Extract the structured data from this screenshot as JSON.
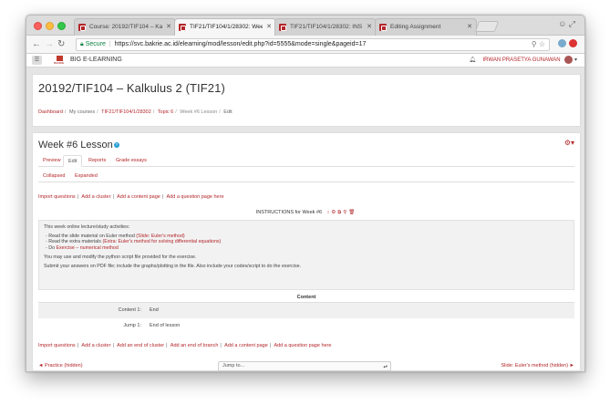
{
  "browser": {
    "tabs": [
      {
        "title": "Course: 20192/TIF104 – Kalk",
        "active": false
      },
      {
        "title": "TIF21/TIF104/1/28302: Wee",
        "active": true
      },
      {
        "title": "TIF21/TIF104/1/28302: INS",
        "active": false
      },
      {
        "title": "Editing Assignment",
        "active": false
      }
    ],
    "secure_label": "Secure",
    "url": "https://svc.bakrie.ac.id/elearning/mod/lesson/edit.php?id=5555&mode=single&pageid=17"
  },
  "navbar": {
    "logo_text": "BAKRIE",
    "site_name": "BIG E-LEARNING",
    "user_name": "IRWAN PRASETYA GUNAWAN"
  },
  "header": {
    "course_title": "20192/TIF104 – Kalkulus 2 (TIF21)",
    "breadcrumb": [
      "Dashboard",
      "My courses",
      "TIF21/TIF104/1/28302",
      "Topic 6",
      "Week #6 Lesson",
      "Edit"
    ]
  },
  "lesson": {
    "title": "Week #6 Lesson",
    "tabs": [
      "Preview",
      "Edit",
      "Reports",
      "Grade essays"
    ],
    "active_tab": "Edit",
    "subtabs": [
      "Collapsed",
      "Expanded"
    ],
    "top_links": [
      "Import questions",
      "Add a cluster",
      "Add a content page",
      "Add a question page here"
    ],
    "page_heading": "INSTRUCTIONS for Week #6",
    "description": {
      "intro": "This week online lecture/study activities:",
      "items": [
        {
          "text": "Read the slide material on Euler method ",
          "link": "(Slide: Euler's method)"
        },
        {
          "text": "Read the extra materials ",
          "link": "(Extra: Euler's method for solving differential equations)"
        },
        {
          "text": "Do ",
          "link": "Exercise – numerical method"
        }
      ],
      "note1": "You may use and modify the python script file provided for the exercise.",
      "note2": "Submit your answers on PDF file; include the graphs/plotting in the file. Also include your codes/script to do the exercise."
    },
    "content_table": {
      "header": "Content",
      "rows": [
        {
          "label": "Content 1:",
          "value": "End"
        },
        {
          "label": "Jump 1:",
          "value": "End of lesson"
        }
      ]
    },
    "bottom_links": [
      "Import questions",
      "Add a cluster",
      "Add an end of cluster",
      "Add an end of branch",
      "Add a content page",
      "Add a question page here"
    ],
    "prev_link": "◄ Practice (hidden)",
    "jump_placeholder": "Jump to...",
    "next_link": "Slide: Euler's method (hidden) ►"
  },
  "colors": {
    "accent": "#b3262a",
    "secure": "#0b8043"
  }
}
